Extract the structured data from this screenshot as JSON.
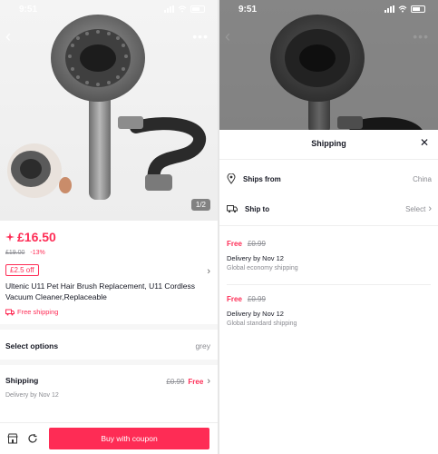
{
  "status_bar": {
    "time": "9:51"
  },
  "gallery": {
    "page_indicator": "1/2"
  },
  "product": {
    "price": "£16.50",
    "original_price": "£19.00",
    "discount": "-13%",
    "coupon": "£2.5 off",
    "title": "Ultenic U11 Pet Hair Brush Replacement, U11 Cordless Vacuum Cleaner,Replaceable",
    "free_shipping": "Free shipping"
  },
  "options": {
    "label": "Select options",
    "value": "grey"
  },
  "shipping": {
    "label": "Shipping",
    "old_price": "£0.99",
    "free": "Free",
    "delivery": "Delivery by Nov 12"
  },
  "bottom": {
    "buy_label": "Buy with coupon"
  },
  "sheet": {
    "title": "Shipping",
    "ships_from_label": "Ships from",
    "ships_from_value": "China",
    "ship_to_label": "Ship to",
    "ship_to_value": "Select",
    "options": [
      {
        "free": "Free",
        "old_price": "£0.99",
        "delivery": "Delivery by Nov 12",
        "method": "Global economy shipping"
      },
      {
        "free": "Free",
        "old_price": "£0.99",
        "delivery": "Delivery by Nov 12",
        "method": "Global standard shipping"
      }
    ]
  },
  "colors": {
    "accent": "#fe2c55",
    "muted": "#8a8b91"
  },
  "icons": [
    "back-icon",
    "more-icon",
    "flash-icon",
    "chevron-right-icon",
    "truck-icon",
    "shop-icon",
    "chat-icon",
    "close-icon",
    "location-icon"
  ]
}
